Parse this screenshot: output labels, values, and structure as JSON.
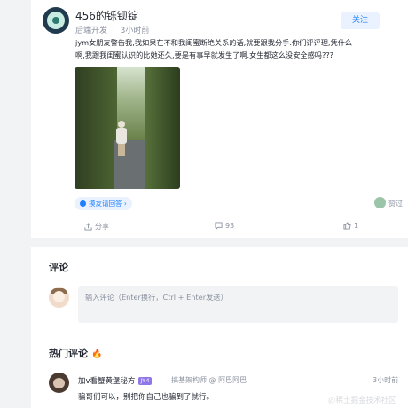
{
  "post": {
    "author": "456的铄钡锭",
    "author_role": "后端开发",
    "time": "3小时前",
    "follow_label": "关注",
    "content": "jym女朋友警告我,我如果在不和我闺蜜断绝关系的话,就要跟我分手.你们评评理,凭什么啊,我跟我闺蜜认识的比她还久,要是有事早就发生了啊.女生都这么没安全感吗???",
    "circle_tag": "摸友请回答",
    "liked_label": "赞过"
  },
  "actions": {
    "share_label": "分享",
    "comment_count": "93",
    "like_count": "1"
  },
  "comments_section": {
    "title": "评论",
    "input_placeholder": "输入评论（Enter换行，Ctrl + Enter发送）",
    "hot_title": "热门评论",
    "hot_icon": "fire-icon",
    "top_comment": {
      "name": "加v看蟹黄堡秘方",
      "badge": "JY.4",
      "role": "搞基架构师 @ 阿巴阿巴",
      "time": "3小时前",
      "text": "骗哥们可以，别把你自己也骗到了就行。"
    }
  },
  "watermark": "@稀土掘金技术社区",
  "colors": {
    "accent": "#1e80ff",
    "accent_bg": "#eaf2ff",
    "muted": "#8a919f",
    "fire": "#f53f3f",
    "badge": "#8f77e8"
  }
}
